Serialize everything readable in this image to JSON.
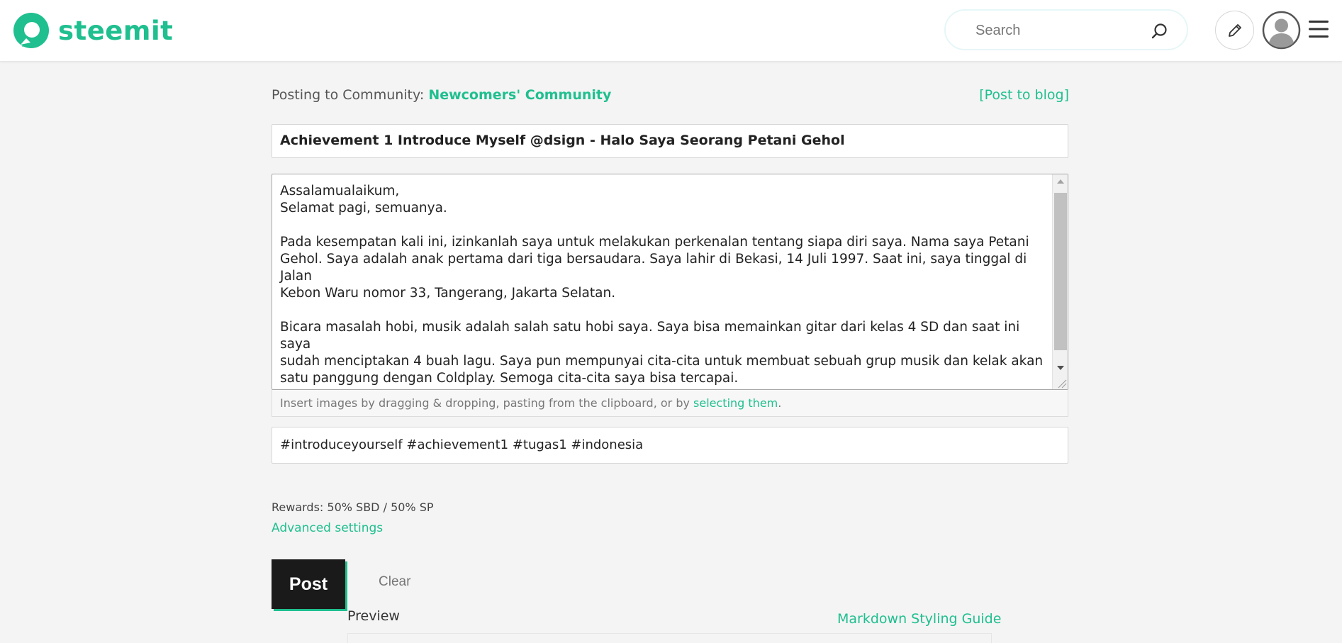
{
  "header": {
    "logo_text": "steemit",
    "search_placeholder": "Search",
    "brand_color": "#1fbf8f"
  },
  "editor": {
    "posting_prefix": "Posting to Community: ",
    "community_name": "Newcomers' Community",
    "post_to_blog": "[Post to blog]",
    "title_value": "Achievement 1 Introduce Myself @dsign - Halo Saya Seorang Petani Gehol",
    "body_lines": [
      "Assalamualaikum,",
      "Selamat pagi, semuanya.",
      "",
      "Pada kesempatan kali ini, izinkanlah saya untuk melakukan perkenalan tentang siapa diri saya. Nama saya Petani",
      "Gehol. Saya adalah anak pertama dari tiga bersaudara. Saya lahir di Bekasi, 14 Juli 1997. Saat ini, saya tinggal di Jalan",
      "Kebon Waru nomor 33, Tangerang, Jakarta Selatan.",
      "",
      "Bicara masalah hobi, musik adalah salah satu hobi saya. Saya bisa memainkan gitar dari kelas 4 SD dan saat ini saya",
      "sudah menciptakan 4 buah lagu. Saya pun mempunyai cita-cita untuk membuat sebuah grup musik dan kelak akan",
      "satu panggung dengan Coldplay. Semoga cita-cita saya bisa tercapai."
    ],
    "upload_hint_prefix": "Insert images by dragging & dropping, pasting from the clipboard, or by ",
    "upload_hint_link": "selecting them",
    "upload_hint_suffix": ".",
    "tags_value": "#introduceyourself #achievement1 #tugas1 #indonesia",
    "rewards": "Rewards: 50% SBD / 50% SP",
    "advanced_settings": "Advanced settings",
    "post_button": "Post",
    "clear_button": "Clear",
    "preview_label": "Preview",
    "markdown_guide": "Markdown Styling Guide"
  }
}
